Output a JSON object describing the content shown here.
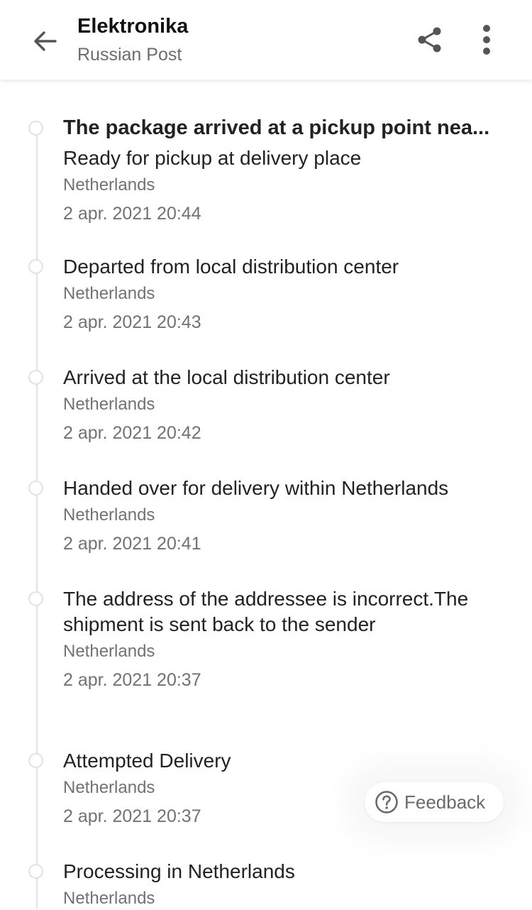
{
  "header": {
    "title": "Elektronika",
    "subtitle": "Russian Post",
    "back_icon": "arrow-left-icon",
    "share_icon": "share-icon",
    "more_icon": "more-vertical-icon"
  },
  "events": [
    {
      "headline": "The package arrived at a pickup point nea...",
      "status": "Ready for pickup at delivery place",
      "location": "Netherlands",
      "time": "2 apr. 2021 20:44"
    },
    {
      "status": "Departed from local distribution center",
      "location": "Netherlands",
      "time": "2 apr. 2021 20:43"
    },
    {
      "status": "Arrived at the local distribution center",
      "location": "Netherlands",
      "time": "2 apr. 2021 20:42"
    },
    {
      "status": "Handed over for delivery within Netherlands",
      "location": "Netherlands",
      "time": "2 apr. 2021 20:41"
    },
    {
      "status": "The address of the addressee is incorrect.The shipment is sent back to the sender",
      "location": "Netherlands",
      "time": "2 apr. 2021 20:37"
    },
    {
      "status": "Attempted Delivery",
      "location": "Netherlands",
      "time": "2 apr. 2021 20:37"
    },
    {
      "status": "Processing in Netherlands",
      "location": "Netherlands"
    }
  ],
  "feedback": {
    "label": "Feedback",
    "icon": "question-circle-icon"
  },
  "colors": {
    "text_primary": "#222222",
    "text_secondary": "#727272",
    "timeline": "#e2e2e2"
  }
}
